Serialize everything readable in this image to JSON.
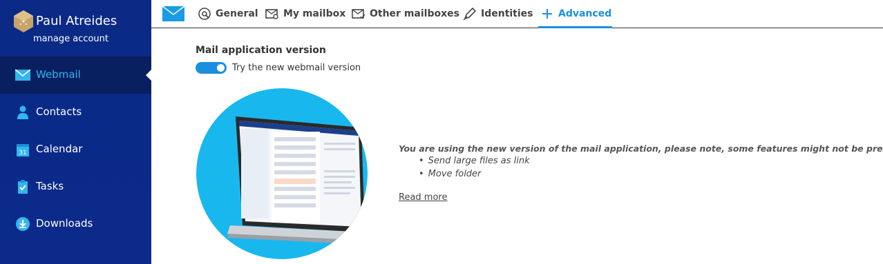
{
  "profile": {
    "name": "Paul Atreides",
    "manage_label": "manage account"
  },
  "sidebar": {
    "items": [
      {
        "label": "Webmail",
        "icon": "mail-icon",
        "active": true
      },
      {
        "label": "Contacts",
        "icon": "person-icon",
        "active": false
      },
      {
        "label": "Calendar",
        "icon": "calendar-icon",
        "active": false
      },
      {
        "label": "Tasks",
        "icon": "clipboard-check-icon",
        "active": false
      },
      {
        "label": "Downloads",
        "icon": "download-icon",
        "active": false
      }
    ],
    "calendar_day": "31"
  },
  "tabs": [
    {
      "label": "General",
      "icon": "settings-cog-icon"
    },
    {
      "label": "My mailbox",
      "icon": "mailbox-icon"
    },
    {
      "label": "Other mailboxes",
      "icon": "shared-mailbox-icon"
    },
    {
      "label": "Identities",
      "icon": "pen-icon"
    },
    {
      "label": "Advanced",
      "icon": "plus-icon",
      "active": true
    }
  ],
  "main": {
    "title": "Mail application version",
    "toggle_label": "Try the new webmail version",
    "toggle_on": true,
    "notice": "You are using the new version of the mail application, please note, some features might not be present yet:",
    "features": [
      "Send large files as link",
      "Move folder"
    ],
    "read_more": "Read more"
  },
  "colors": {
    "sidebar_bg": "#0a2a86",
    "active_bg": "#082060",
    "accent": "#1a8fe0",
    "illustration_circle": "#18b8ee"
  }
}
